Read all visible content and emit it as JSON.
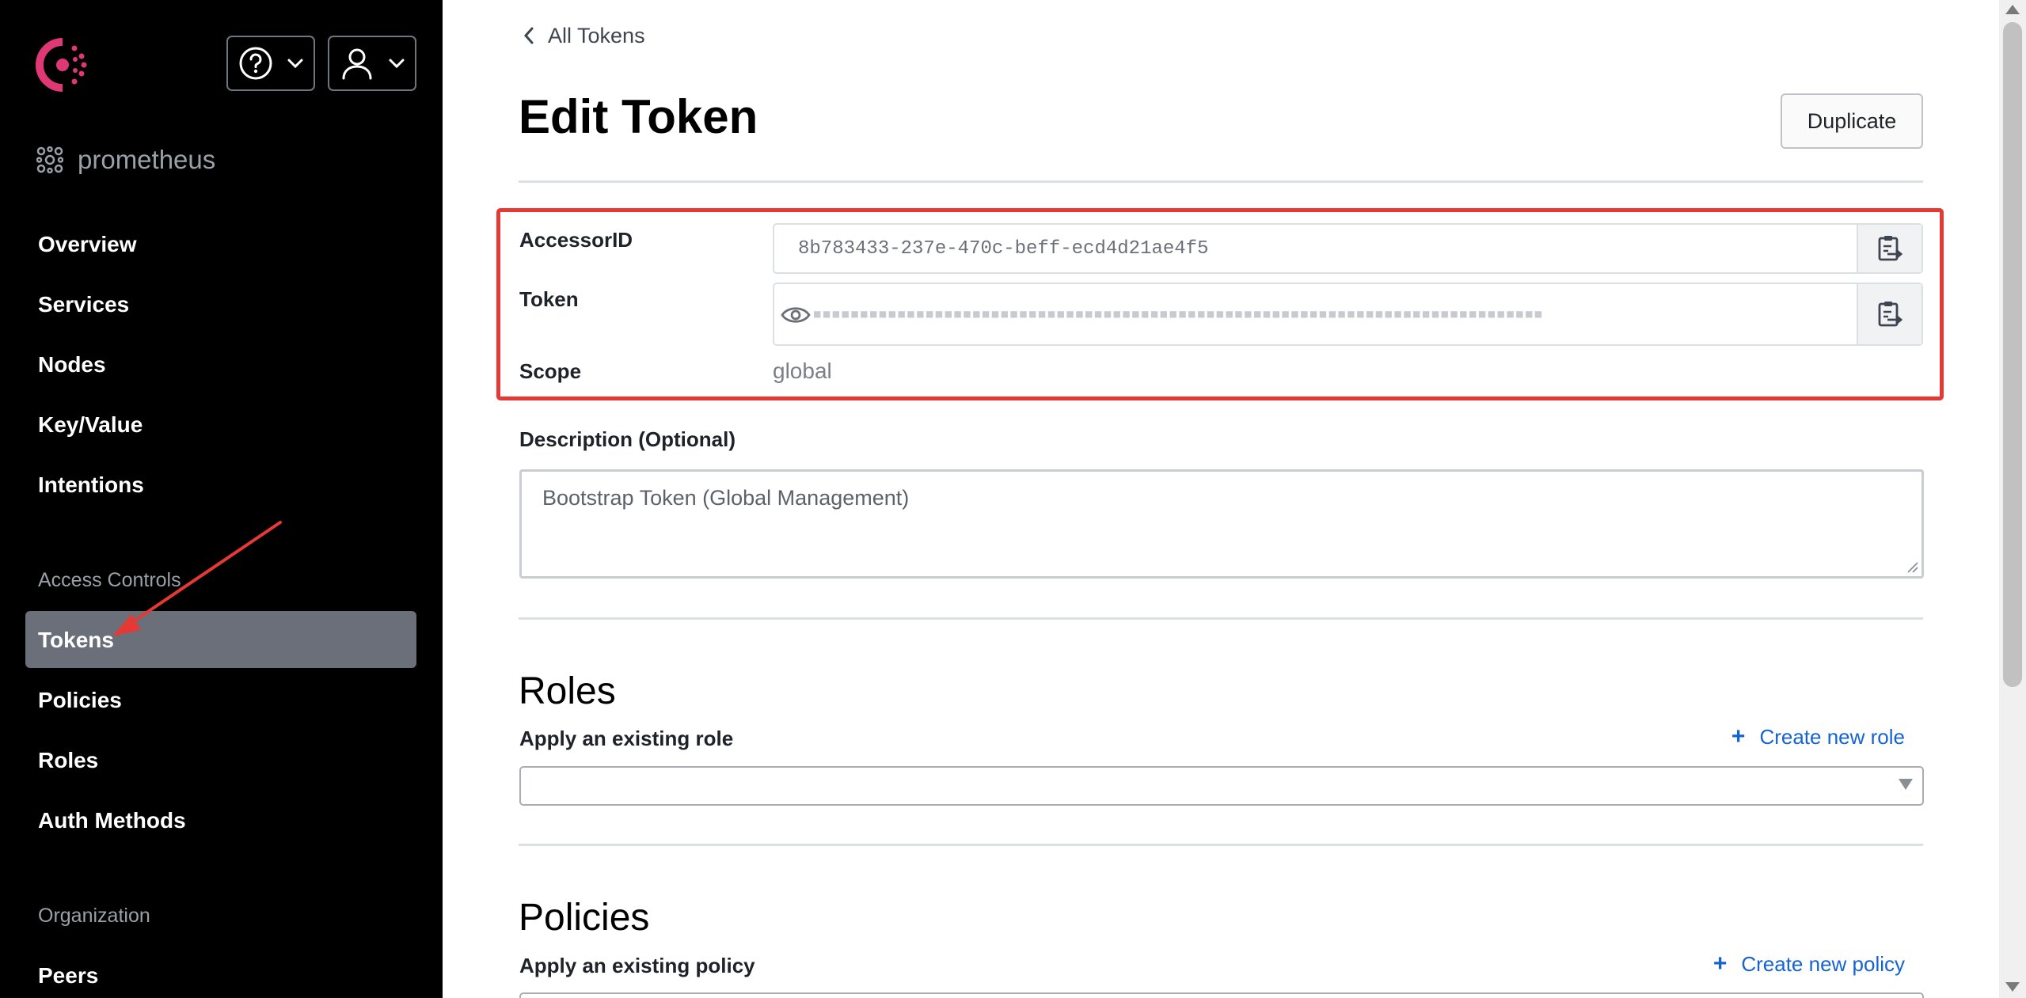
{
  "app": {
    "brand_color": "#e03875",
    "logo_icon": "consul-logo-icon"
  },
  "header": {
    "help_icon": "help-circle-icon",
    "user_icon": "user-icon",
    "chevron_icon": "chevron-down-icon"
  },
  "datacenter": {
    "name": "prometheus",
    "icon": "datacenter-icon"
  },
  "sidebar": {
    "items": [
      {
        "label": "Overview"
      },
      {
        "label": "Services"
      },
      {
        "label": "Nodes"
      },
      {
        "label": "Key/Value"
      },
      {
        "label": "Intentions"
      }
    ],
    "access_controls": {
      "heading": "Access Controls",
      "items": [
        {
          "label": "Tokens",
          "active": true
        },
        {
          "label": "Policies"
        },
        {
          "label": "Roles"
        },
        {
          "label": "Auth Methods"
        }
      ]
    },
    "organization": {
      "heading": "Organization",
      "items": [
        {
          "label": "Peers"
        }
      ]
    },
    "active_bg": "#6b6f7a"
  },
  "annotation": {
    "color": "#e53935"
  },
  "main": {
    "back_label": "All Tokens",
    "title": "Edit Token",
    "duplicate_label": "Duplicate",
    "fields": {
      "accessor_label": "AccessorID",
      "accessor_value": "8b783433-237e-470c-beff-ecd4d21ae4f5",
      "token_label": "Token",
      "token_masked": "■■■■■■■■■■■■■■■■■■■■■■■■■■■■■■■■■■■■■■■■■■■■■■■■■■■■■■■■■■■■■■■■■■■■■■■■■■■■■■",
      "scope_label": "Scope",
      "scope_value": "global"
    },
    "description": {
      "label": "Description (Optional)",
      "value": "Bootstrap Token (Global Management)"
    },
    "roles": {
      "title": "Roles",
      "apply_label": "Apply an existing role",
      "create_label": "Create new role",
      "create_icon": "+"
    },
    "policies": {
      "title": "Policies",
      "apply_label": "Apply an existing policy",
      "create_label": "Create new policy",
      "create_icon": "+"
    },
    "link_color": "#1563d3"
  }
}
